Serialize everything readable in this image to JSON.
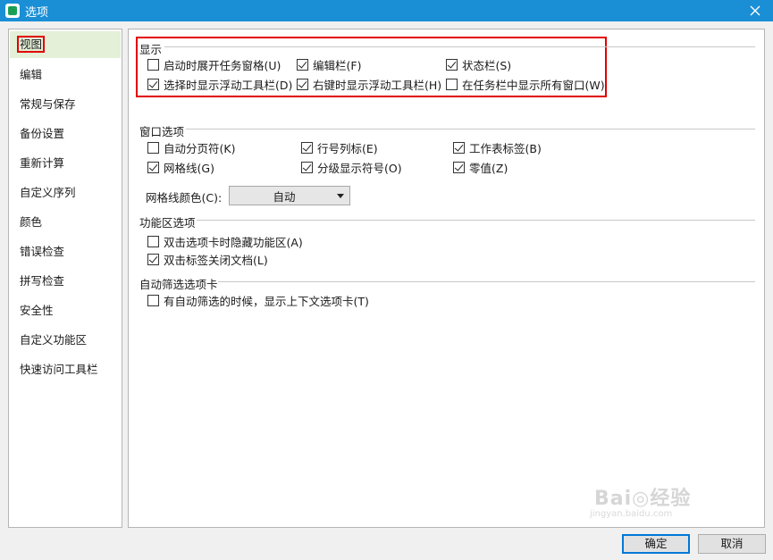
{
  "window": {
    "title": "选项",
    "app_icon": "wps-s-icon",
    "close_icon": "close-icon"
  },
  "sidebar": {
    "items": [
      {
        "label": "视图",
        "active": true
      },
      {
        "label": "编辑"
      },
      {
        "label": "常规与保存"
      },
      {
        "label": "备份设置"
      },
      {
        "label": "重新计算"
      },
      {
        "label": "自定义序列"
      },
      {
        "label": "颜色"
      },
      {
        "label": "错误检查"
      },
      {
        "label": "拼写检查"
      },
      {
        "label": "安全性"
      },
      {
        "label": "自定义功能区"
      },
      {
        "label": "快速访问工具栏"
      }
    ]
  },
  "display": {
    "title": "显示",
    "options": [
      {
        "label": "启动时展开任务窗格(U)",
        "checked": false
      },
      {
        "label": "编辑栏(F)",
        "checked": true
      },
      {
        "label": "状态栏(S)",
        "checked": true
      },
      {
        "label": "选择时显示浮动工具栏(D)",
        "checked": true
      },
      {
        "label": "右键时显示浮动工具栏(H)",
        "checked": true
      },
      {
        "label": "在任务栏中显示所有窗口(W)",
        "checked": false
      }
    ]
  },
  "window_options": {
    "title": "窗口选项",
    "options": [
      {
        "label": "自动分页符(K)",
        "checked": false
      },
      {
        "label": "行号列标(E)",
        "checked": true
      },
      {
        "label": "工作表标签(B)",
        "checked": true
      },
      {
        "label": "网格线(G)",
        "checked": true
      },
      {
        "label": "分级显示符号(O)",
        "checked": true
      },
      {
        "label": "零值(Z)",
        "checked": true
      }
    ],
    "grid_color_label": "网格线颜色(C):",
    "grid_color_value": "自动"
  },
  "ribbon_options": {
    "title": "功能区选项",
    "options": [
      {
        "label": "双击选项卡时隐藏功能区(A)",
        "checked": false
      },
      {
        "label": "双击标签关闭文档(L)",
        "checked": true
      }
    ]
  },
  "autofilter": {
    "title": "自动筛选选项卡",
    "options": [
      {
        "label": "有自动筛选的时候，显示上下文选项卡(T)",
        "checked": false
      }
    ]
  },
  "watermark": {
    "text": "Bai◎经验",
    "sub": "jingyan.baidu.com"
  },
  "buttons": {
    "ok": "确定",
    "cancel": "取消"
  }
}
